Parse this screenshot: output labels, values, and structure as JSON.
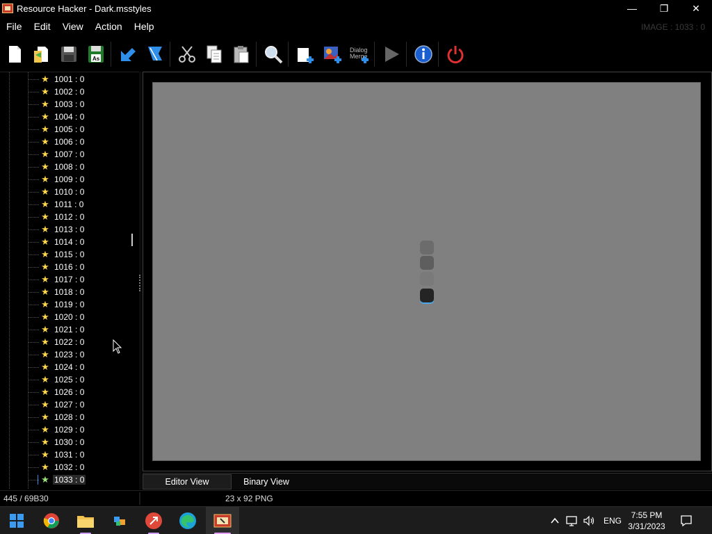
{
  "window": {
    "title": "Resource Hacker - Dark.msstyles",
    "minimize_glyph": "—",
    "restore_glyph": "❐",
    "close_glyph": "✕"
  },
  "menu": [
    "File",
    "Edit",
    "View",
    "Action",
    "Help"
  ],
  "image_readout": "IMAGE : 1033 : 0",
  "toolbar": {
    "buttons": [
      {
        "name": "new-icon"
      },
      {
        "name": "open-icon"
      },
      {
        "name": "save-icon"
      },
      {
        "name": "save-as-icon",
        "label": "As"
      },
      {
        "name": "compile-icon"
      },
      {
        "name": "bookmark-icon"
      },
      {
        "name": "cut-icon"
      },
      {
        "name": "copy-icon"
      },
      {
        "name": "paste-icon"
      },
      {
        "name": "find-icon"
      },
      {
        "name": "add-blank-resource-icon"
      },
      {
        "name": "add-image-resource-icon"
      },
      {
        "name": "add-dialog-merge-icon",
        "label": "Dialog Merge"
      },
      {
        "name": "run-icon"
      },
      {
        "name": "about-icon"
      },
      {
        "name": "exit-icon"
      }
    ],
    "colors": {
      "accent_blue": "#2f8fe8",
      "exit_red": "#e03030",
      "about_blue": "#1a5fd0"
    }
  },
  "tree": {
    "items": [
      "1001 : 0",
      "1002 : 0",
      "1003 : 0",
      "1004 : 0",
      "1005 : 0",
      "1006 : 0",
      "1007 : 0",
      "1008 : 0",
      "1009 : 0",
      "1010 : 0",
      "1011 : 0",
      "1012 : 0",
      "1013 : 0",
      "1014 : 0",
      "1015 : 0",
      "1016 : 0",
      "1017 : 0",
      "1018 : 0",
      "1019 : 0",
      "1020 : 0",
      "1021 : 0",
      "1022 : 0",
      "1023 : 0",
      "1024 : 0",
      "1025 : 0",
      "1026 : 0",
      "1027 : 0",
      "1028 : 0",
      "1029 : 0",
      "1030 : 0",
      "1031 : 0",
      "1032 : 0",
      "1033 : 0"
    ],
    "selected": "1033 : 0",
    "star_glyph": "★"
  },
  "tabs": {
    "editor": "Editor View",
    "binary": "Binary View"
  },
  "status": {
    "position": "445 / 69B30",
    "image_info": "23 x 92  PNG"
  },
  "taskbar": {
    "apps": [
      {
        "name": "start-icon"
      },
      {
        "name": "chrome-icon"
      },
      {
        "name": "file-explorer-icon"
      },
      {
        "name": "pinned-app-icon"
      },
      {
        "name": "remote-app-icon"
      },
      {
        "name": "edge-icon"
      },
      {
        "name": "resource-hacker-icon"
      }
    ],
    "tray": {
      "language": "ENG",
      "time": "7:55 PM",
      "date": "3/31/2023"
    }
  }
}
